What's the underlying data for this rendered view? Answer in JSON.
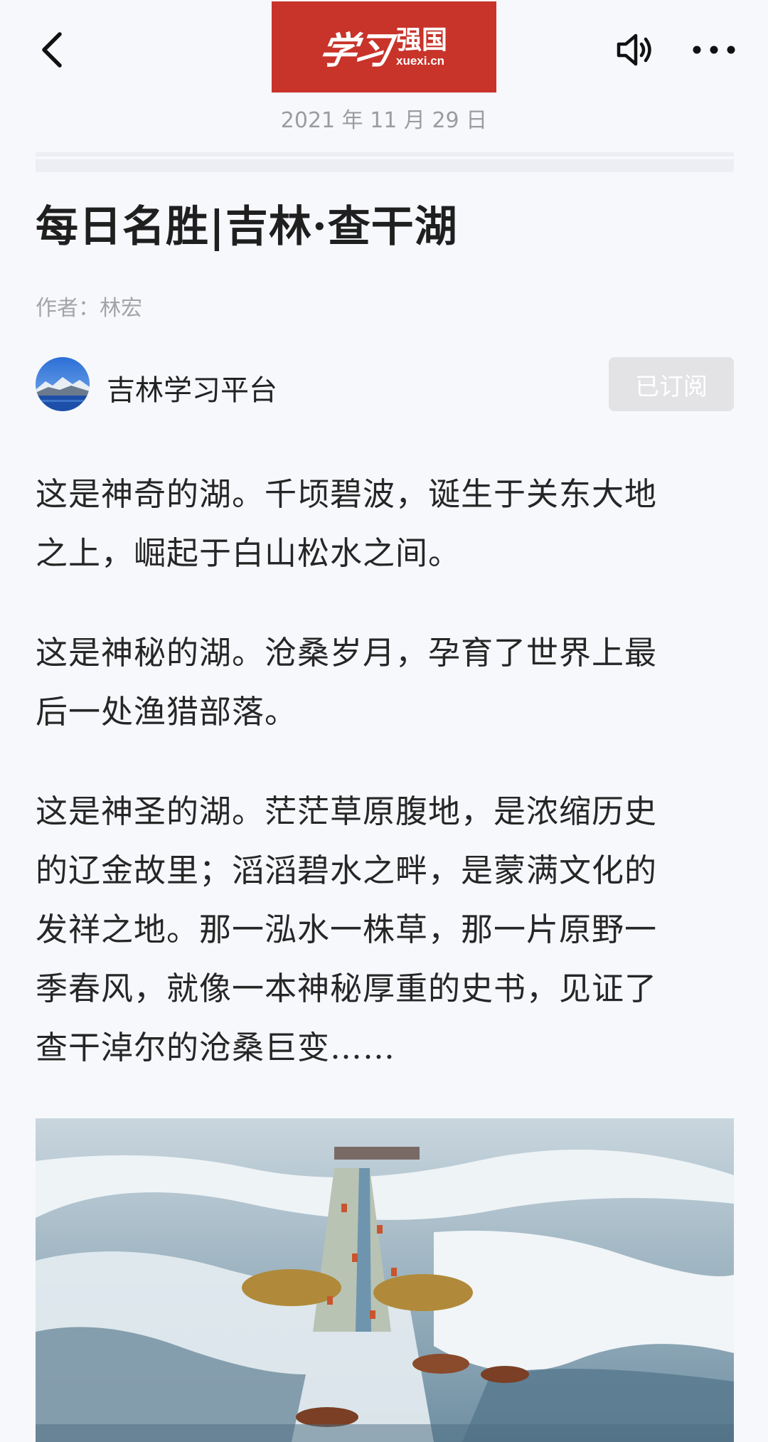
{
  "header": {
    "logo_calligraphy": "学习",
    "logo_text": "强国",
    "logo_domain": "xuexi.cn",
    "date": "2021 年 11 月 29 日"
  },
  "article": {
    "title": "每日名胜|吉林·查干湖",
    "author": "作者：林宏",
    "channel": {
      "name": "吉林学习平台",
      "subscribe_label": "已订阅"
    },
    "paragraphs": [
      [
        "这是神奇的湖。千顷碧波，诞生于关东大地",
        "之上，崛起于白山松水之间。"
      ],
      [
        "这是神秘的湖。沧桑岁月，孕育了世界上最",
        "后一处渔猎部落。"
      ],
      [
        "这是神圣的湖。茫茫草原腹地，是浓缩历史",
        "的辽金故里；滔滔碧水之畔，是蒙满文化的",
        "发祥之地。那一泓水一株草，那一片原野一",
        "季春风，就像一本神秘厚重的史书，见证了",
        "查干淖尔的沧桑巨变……"
      ]
    ]
  },
  "icons": {
    "back": "chevron-left-icon",
    "speaker": "speaker-icon",
    "more": "more-icon"
  },
  "colors": {
    "brand_red": "#c8332a",
    "background": "#f7f8fc",
    "subscribed_button": "#e3e3e5"
  }
}
